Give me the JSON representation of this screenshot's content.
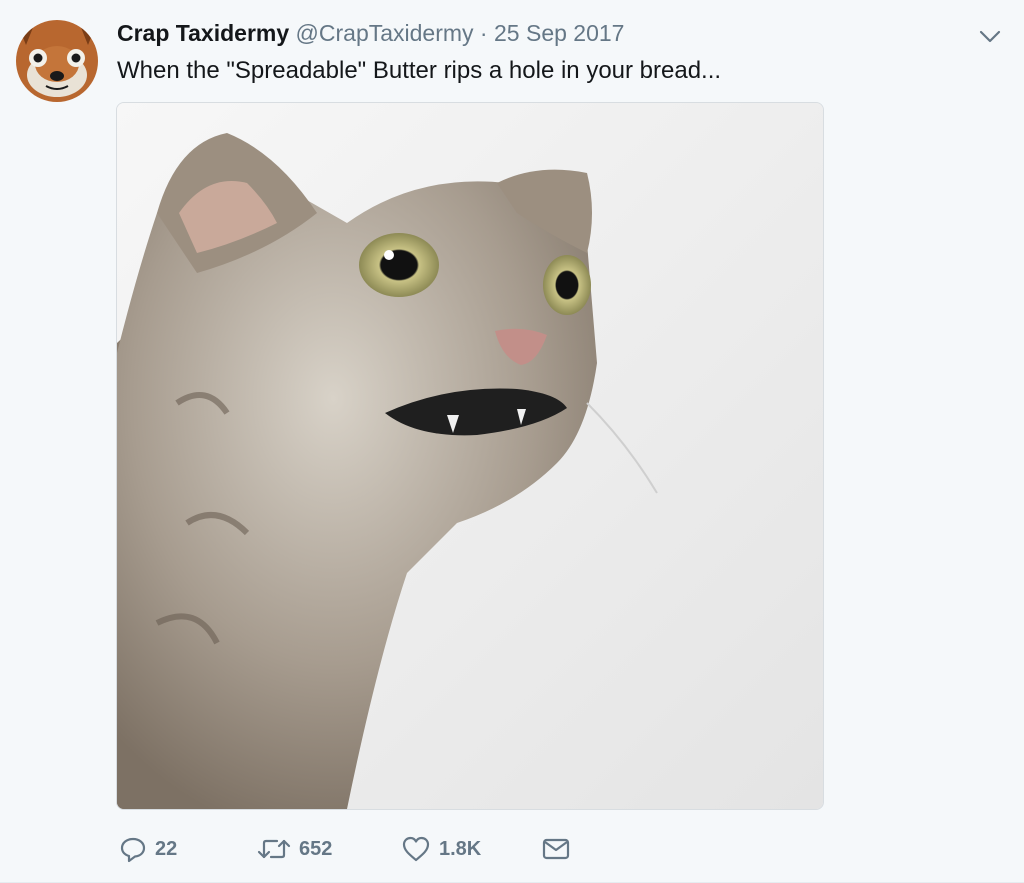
{
  "tweet": {
    "author_name": "Crap Taxidermy",
    "handle": "@CrapTaxidermy",
    "separator": " · ",
    "date": "25 Sep 2017",
    "text": "When the \"Spreadable\" Butter rips a hole in your bread...",
    "media_subject": "taxidermy-cat-photo",
    "avatar_subject": "taxidermy-fox-face"
  },
  "actions": {
    "reply_count": "22",
    "retweet_count": "652",
    "like_count": "1.8K"
  },
  "colors": {
    "text_primary": "#14171a",
    "text_secondary": "#657786",
    "background": "#f5f8fa",
    "border": "#d8dde1"
  },
  "icons": [
    "chevron-down-icon",
    "reply-icon",
    "retweet-icon",
    "heart-icon",
    "message-icon"
  ]
}
